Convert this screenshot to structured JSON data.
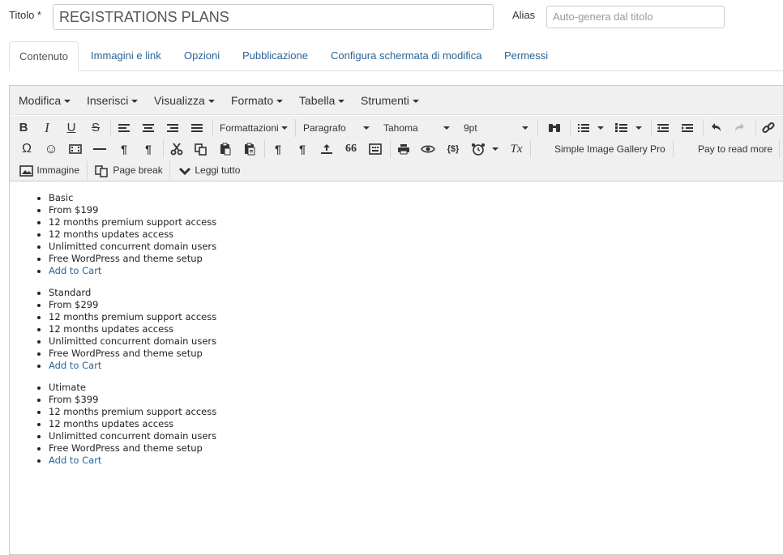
{
  "form": {
    "title_label": "Titolo *",
    "title_value": "REGISTRATIONS PLANS",
    "alias_label": "Alias",
    "alias_placeholder": "Auto-genera dal titolo"
  },
  "tabs": [
    {
      "label": "Contenuto",
      "active": true
    },
    {
      "label": "Immagini e link"
    },
    {
      "label": "Opzioni"
    },
    {
      "label": "Pubblicazione"
    },
    {
      "label": "Configura schermata di modifica"
    },
    {
      "label": "Permessi"
    }
  ],
  "menubar": [
    "Modifica",
    "Inserisci",
    "Visualizza",
    "Formato",
    "Tabella",
    "Strumenti"
  ],
  "toolbar": {
    "bold": "B",
    "italic": "I",
    "underline": "U",
    "strike": "S",
    "formats": "Formattazioni",
    "block": "Paragrafo",
    "font": "Tahoma",
    "size": "9pt",
    "gallery": "Simple Image Gallery Pro",
    "pay": "Pay to read more",
    "image": "Immagine",
    "pagebreak": "Page break",
    "readmore": "Leggi tutto"
  },
  "icons": {
    "omega": "Ω",
    "smiley": "☺",
    "pilcrow": "¶",
    "quote": "66",
    "code": "{$}",
    "clearformat": "Tx"
  },
  "plans": [
    {
      "name": "Basic",
      "price": "From $199",
      "f1": "12 months premium support access",
      "f2": "12 months updates access",
      "f3": "Unlimitted concurrent domain users",
      "f4": "Free WordPress and theme setup",
      "cta": "Add to Cart"
    },
    {
      "name": "Standard",
      "price": "From $299",
      "f1": "12 months premium support access",
      "f2": "12 months updates access",
      "f3": "Unlimitted concurrent domain users",
      "f4": "Free WordPress and theme setup",
      "cta": "Add to Cart"
    },
    {
      "name": "Utimate",
      "price": "From $399",
      "f1": "12 months premium support access",
      "f2": "12 months updates access",
      "f3": "Unlimitted concurrent domain users",
      "f4": "Free WordPress and theme setup",
      "cta": "Add to Cart"
    }
  ]
}
